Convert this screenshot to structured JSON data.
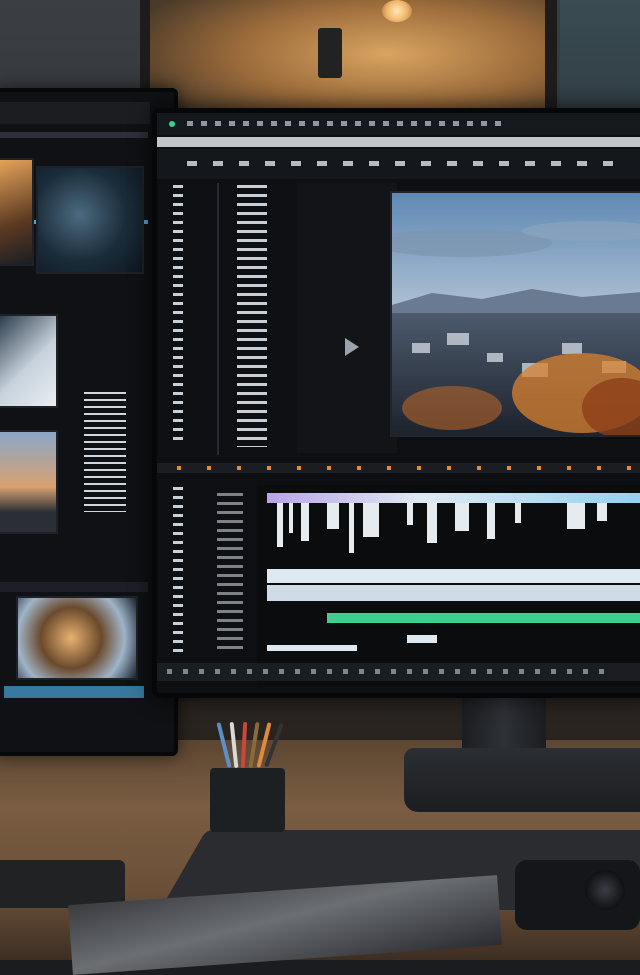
{
  "scene": {
    "description_colors": {
      "accent_blue": "#4aa2d8",
      "warm_light": "#d9a460",
      "desk_wood": "#7a5d42",
      "audio_green": "#3ecf8e",
      "video_track": "#dfe9f2",
      "audio_purple": "#b9a3e6"
    },
    "icons": [
      "play-icon"
    ]
  }
}
